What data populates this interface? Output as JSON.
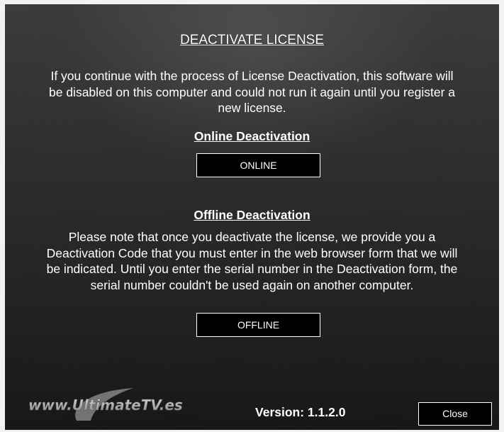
{
  "dialog": {
    "title": "DEACTIVATE LICENSE",
    "intro_lines": [
      "If you continue with the process of License Deactivation, this software will",
      "be disabled on this computer and could not run it again until you register a",
      "new license."
    ]
  },
  "online": {
    "heading": "Online Deactivation",
    "button_label": "ONLINE"
  },
  "offline": {
    "heading": "Offline Deactivation",
    "description_lines": [
      "Please note that once you deactivate the license, we provide you a",
      "Deactivation Code that you must enter in the web browser form that we will",
      "be indicated. Until you enter the serial number in the Deactivation form, the",
      "serial number couldn't be used again on another computer."
    ],
    "button_label": "OFFLINE"
  },
  "footer": {
    "logo_text": "www.UltimateTV.es",
    "version_text": "Version: 1.1.2.0",
    "close_label": "Close"
  },
  "colors": {
    "background": "#2a2a2a",
    "text": "#ffffff",
    "button_bg": "#000000",
    "frame": "#f2f2f2"
  }
}
